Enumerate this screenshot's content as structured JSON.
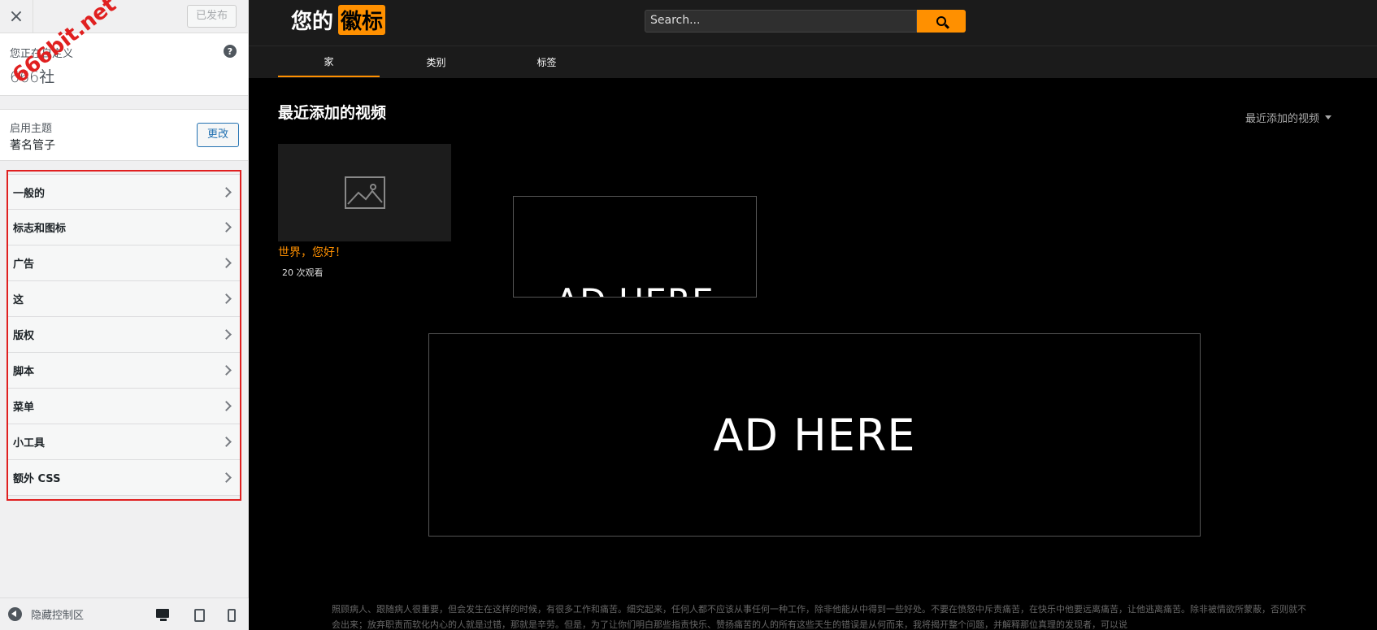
{
  "panel": {
    "close_glyph": "×",
    "publish_label": "已发布",
    "customizing_label": "您正在自定义",
    "site_name": "666社",
    "help_glyph": "?",
    "watermark": "666bit.net",
    "theme_label": "启用主题",
    "theme_name": "著名管子",
    "change_label": "更改",
    "menu": [
      {
        "label": "一般的"
      },
      {
        "label": "标志和图标"
      },
      {
        "label": "广告"
      },
      {
        "label": "这"
      },
      {
        "label": "版权"
      },
      {
        "label": "脚本"
      },
      {
        "label": "菜单"
      },
      {
        "label": "小工具"
      },
      {
        "label": "额外 CSS"
      }
    ],
    "hide_controls_label": "隐藏控制区"
  },
  "preview": {
    "logo_text": "您的",
    "logo_highlight": "徽标",
    "search_placeholder": "Search...",
    "nav": [
      {
        "label": "家",
        "active": true
      },
      {
        "label": "类别",
        "active": false
      },
      {
        "label": "标签",
        "active": false
      }
    ],
    "section_title": "最近添加的视频",
    "sort_label": "最近添加的视频",
    "video": {
      "title": "世界，您好！",
      "views": "20 次观看"
    },
    "ad_small": "AD HERE",
    "ad_big": "AD HERE",
    "footer_text": "照顾病人、跟随病人很重要，但会发生在这样的时候，有很多工作和痛苦。细究起来，任何人都不应该从事任何一种工作，除非他能从中得到一些好处。不要在愤怒中斥责痛苦，在快乐中他要远离痛苦，让他逃离痛苦。除非被情欲所蒙蔽，否则就不会出来；放弃职责而软化内心的人就是过错，那就是辛劳。但是，为了让你们明白那些指责快乐、赞扬痛苦的人的所有这些天生的错误是从何而来，我将揭开整个问题，并解释那位真理的发现者，可以说"
  },
  "colors": {
    "accent": "#ff9000",
    "highlight_border": "#e02020",
    "link_blue": "#2271b1"
  }
}
